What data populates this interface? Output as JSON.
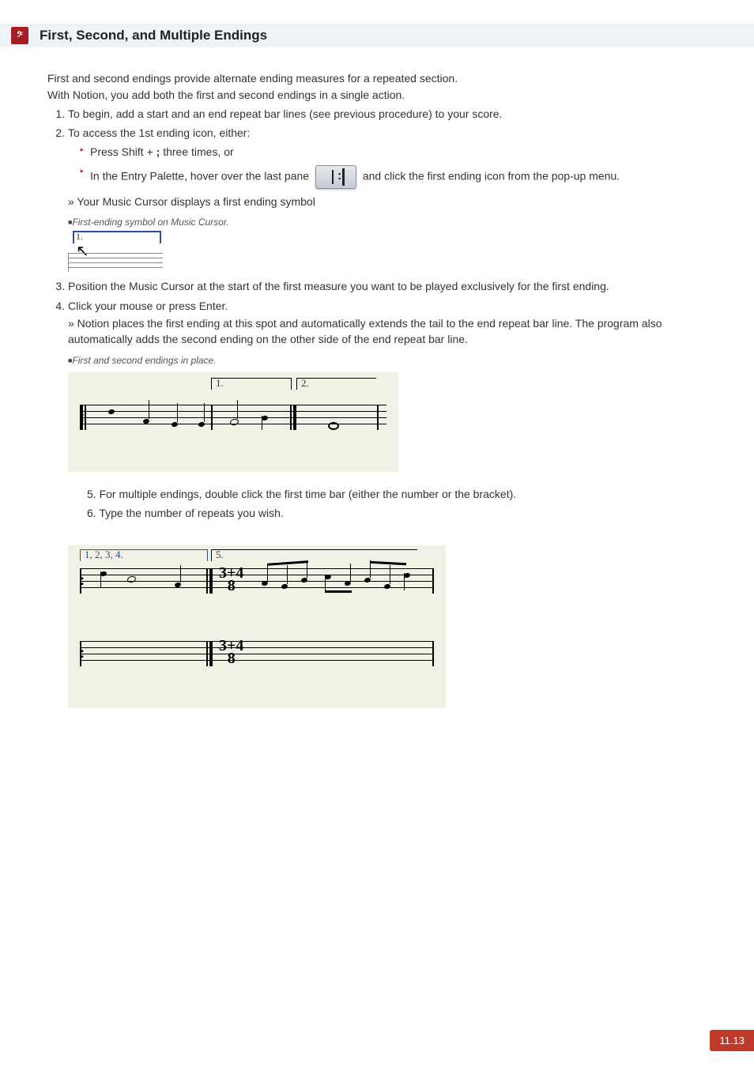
{
  "header": {
    "title": "First, Second, and Multiple Endings"
  },
  "intro": {
    "line1": "First and second endings provide alternate ending measures for a repeated section.",
    "line2": "With Notion, you add both the first and second endings in a single action."
  },
  "steps": {
    "s1": "To begin, add a start and an end repeat bar lines (see previous procedure) to your score.",
    "s2": "To access the 1st ending icon, either:",
    "s2a_pre": "Press Shift + ",
    "s2a_key": ";",
    "s2a_post": " three times, or",
    "s2b_pre": "In the Entry Palette, hover over the last pane",
    "s2b_post": "and click the first ending icon from the pop-up menu.",
    "s2_result": "» Your Music Cursor displays a first ending symbol",
    "caption1": "First-ending symbol on Music Cursor.",
    "cursor_num": "1.",
    "s3": "Position the Music Cursor at the start of the first measure you want to be played exclusively for the first ending.",
    "s4": "Click your mouse or press Enter.",
    "s4_result": "» Notion places the first ending at this spot and automatically extends the tail to the end repeat bar line. The program also automatically adds the second ending on the other side of the end repeat bar line.",
    "caption2": "First and second endings in place.",
    "fig2_num1": "1.",
    "fig2_num2": "2.",
    "s5": "5. For multiple endings, double click the first time bar (either the number or the bracket).",
    "s6": "6. Type the number of repeats you wish.",
    "fig3_label1": "1, 2, 3, 4.",
    "fig3_label2": "5.",
    "fig3_timesig_top": "3+4",
    "fig3_timesig_bot": "8"
  },
  "page_number": "11.13"
}
